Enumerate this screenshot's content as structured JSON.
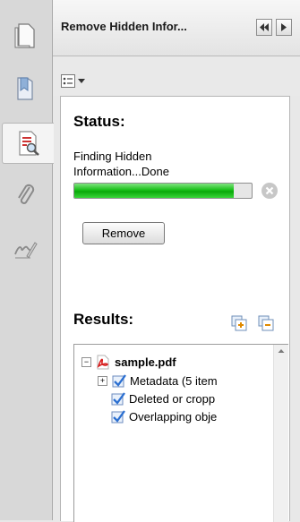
{
  "panel": {
    "title": "Remove Hidden Infor...",
    "status_heading": "Status:",
    "status_text": "Finding Hidden Information...Done",
    "progress_fraction": 0.9,
    "remove_label": "Remove",
    "results_heading": "Results:"
  },
  "rail": {
    "icons": [
      "pages-icon",
      "bookmarks-icon",
      "hidden-info-search-icon",
      "attachments-icon",
      "signatures-icon"
    ],
    "active_index": 2
  },
  "tree": {
    "root": "sample.pdf",
    "items": [
      "Metadata (5 item",
      "Deleted or cropp",
      "Overlapping obje"
    ]
  },
  "colors": {
    "progress_green": "#19c019",
    "check_blue": "#2b6fd1",
    "pdf_red": "#d71f1f"
  }
}
